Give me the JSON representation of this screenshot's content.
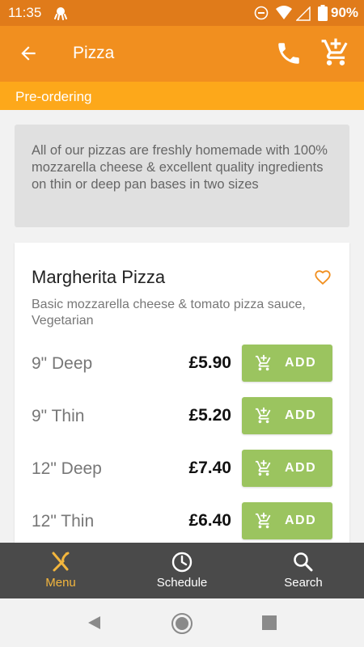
{
  "status_bar": {
    "time": "11:35",
    "battery": "90%"
  },
  "app_bar": {
    "title": "Pizza"
  },
  "banner": {
    "text": "Pre-ordering"
  },
  "category": {
    "description": "All of our pizzas are freshly homemade with 100% mozzarella cheese & excellent quality ingredients on thin or deep pan bases in two sizes"
  },
  "item": {
    "name": "Margherita Pizza",
    "description": "Basic mozzarella cheese & tomato pizza sauce, Vegetarian",
    "options": [
      {
        "size": "9\" Deep",
        "price": "£5.90",
        "add_label": "ADD"
      },
      {
        "size": "9\" Thin",
        "price": "£5.20",
        "add_label": "ADD"
      },
      {
        "size": "12\" Deep",
        "price": "£7.40",
        "add_label": "ADD"
      },
      {
        "size": "12\" Thin",
        "price": "£6.40",
        "add_label": "ADD"
      }
    ]
  },
  "bottom_nav": {
    "items": [
      {
        "label": "Menu",
        "icon": "fork-knife-icon",
        "active": true
      },
      {
        "label": "Schedule",
        "icon": "clock-icon",
        "active": false
      },
      {
        "label": "Search",
        "icon": "search-icon",
        "active": false
      }
    ]
  },
  "colors": {
    "status_bar": "#e07b1a",
    "app_bar": "#f18f1f",
    "banner": "#fda81a",
    "add_button": "#9bc45f",
    "nav_active": "#f3b63d",
    "nav_bg": "#4a4a4a"
  }
}
